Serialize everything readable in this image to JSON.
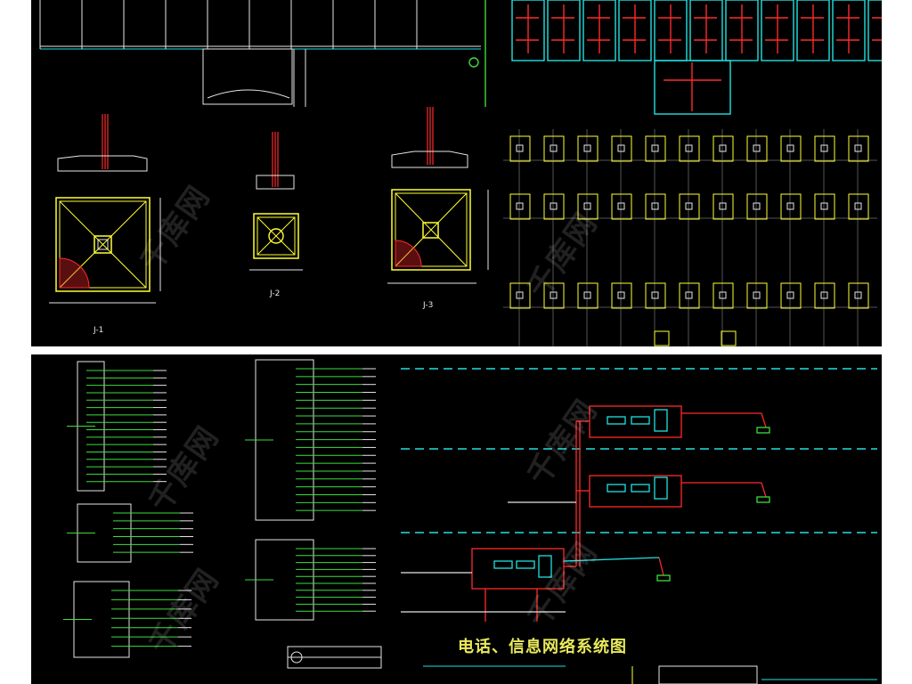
{
  "watermark": "千库网",
  "top_sheet": {
    "details": [
      {
        "label": "J-1"
      },
      {
        "label": "J-2"
      },
      {
        "label": "J-3"
      }
    ]
  },
  "bottom_sheet": {
    "system_title": "电话、信息网络系统图"
  },
  "colors": {
    "background": "#000000",
    "page": "#ffffff",
    "structure": "#e6e6e6",
    "column": "#ff2a2a",
    "footing": "#ffff33",
    "grid": "#22e0e0",
    "wire": "#3ddc3d",
    "title": "#e9e95c"
  }
}
